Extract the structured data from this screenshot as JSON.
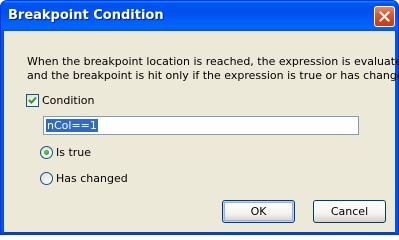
{
  "window": {
    "title": "Breakpoint Condition",
    "close_icon": "close-icon"
  },
  "dialog": {
    "description_line1": "When the breakpoint location is reached, the expression is evaluated",
    "description_line2": "and the breakpoint is hit only if the expression is true or has changed.",
    "condition_checkbox": {
      "label": "Condition",
      "checked": true
    },
    "expression": {
      "value": "nCol==1"
    },
    "options": [
      {
        "label": "Is true",
        "selected": true
      },
      {
        "label": "Has changed",
        "selected": false
      }
    ],
    "buttons": {
      "ok_label": "OK",
      "cancel_label": "Cancel"
    }
  },
  "colors": {
    "titlebar": "#0054e3",
    "client_bg": "#ece9d8",
    "selection": "#316ac5",
    "radio_dot": "#21a121",
    "checkmark": "#21a121"
  }
}
